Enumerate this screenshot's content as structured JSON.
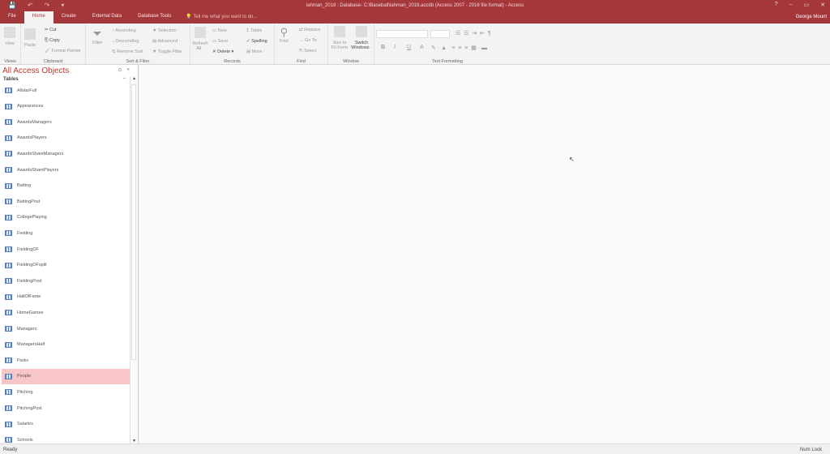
{
  "titlebar": {
    "title": "lahman_2018 : Database- C:\\Baseball\\lahman_2018.accdb (Access 2007 - 2016 file format) - Access",
    "user": "George Mount",
    "help": "?",
    "minimize": "–",
    "restore": "▭",
    "close": "✕",
    "qat": [
      "💾",
      "↶",
      "↷",
      "▾"
    ]
  },
  "tabs": [
    "File",
    "Home",
    "Create",
    "External Data",
    "Database Tools"
  ],
  "tellme": "Tell me what you want to do...",
  "ribbon": {
    "views": {
      "label": "Views",
      "view": "View"
    },
    "clipboard": {
      "label": "Clipboard",
      "paste": "Paste",
      "cut": "Cut",
      "copy": "Copy",
      "format_painter": "Format Painter"
    },
    "sort_filter": {
      "label": "Sort & Filter",
      "filter": "Filter",
      "ascending": "Ascending",
      "descending": "Descending",
      "remove_sort": "Remove Sort",
      "selection": "Selection ·",
      "advanced": "Advanced ·",
      "toggle_filter": "Toggle Filter"
    },
    "records": {
      "label": "Records",
      "refresh": "Refresh All ·",
      "new": "New",
      "save": "Save",
      "delete": "Delete",
      "totals": "Totals",
      "spelling": "Spelling",
      "more": "More ·"
    },
    "find": {
      "label": "Find",
      "find": "Find",
      "replace": "Replace",
      "goto": "Go To ·",
      "select": "Select ·"
    },
    "window": {
      "label": "Window",
      "size_to_fit": "Size to Fit Form",
      "switch": "Switch Windows ·"
    },
    "text_formatting": {
      "label": "Text Formatting",
      "bold": "B",
      "italic": "I",
      "underline": "U",
      "font_color": "A"
    }
  },
  "nav": {
    "title": "All Access Objects",
    "section": "Tables",
    "items": [
      "AllstarFull",
      "Appearances",
      "AwardsManagers",
      "AwardsPlayers",
      "AwardsShareManagers",
      "AwardsSharePlayers",
      "Batting",
      "BattingPost",
      "CollegePlaying",
      "Fielding",
      "FieldingOF",
      "FieldingOFsplit",
      "FieldingPost",
      "HallOfFame",
      "HomeGames",
      "Managers",
      "ManagersHalf",
      "Parks",
      "People",
      "Pitching",
      "PitchingPost",
      "Salaries",
      "Schools"
    ],
    "selected": "People"
  },
  "status": {
    "left": "Ready",
    "right": "Num Lock"
  },
  "colors": {
    "accent": "#a4373a",
    "selected": "#f8c6c6"
  }
}
